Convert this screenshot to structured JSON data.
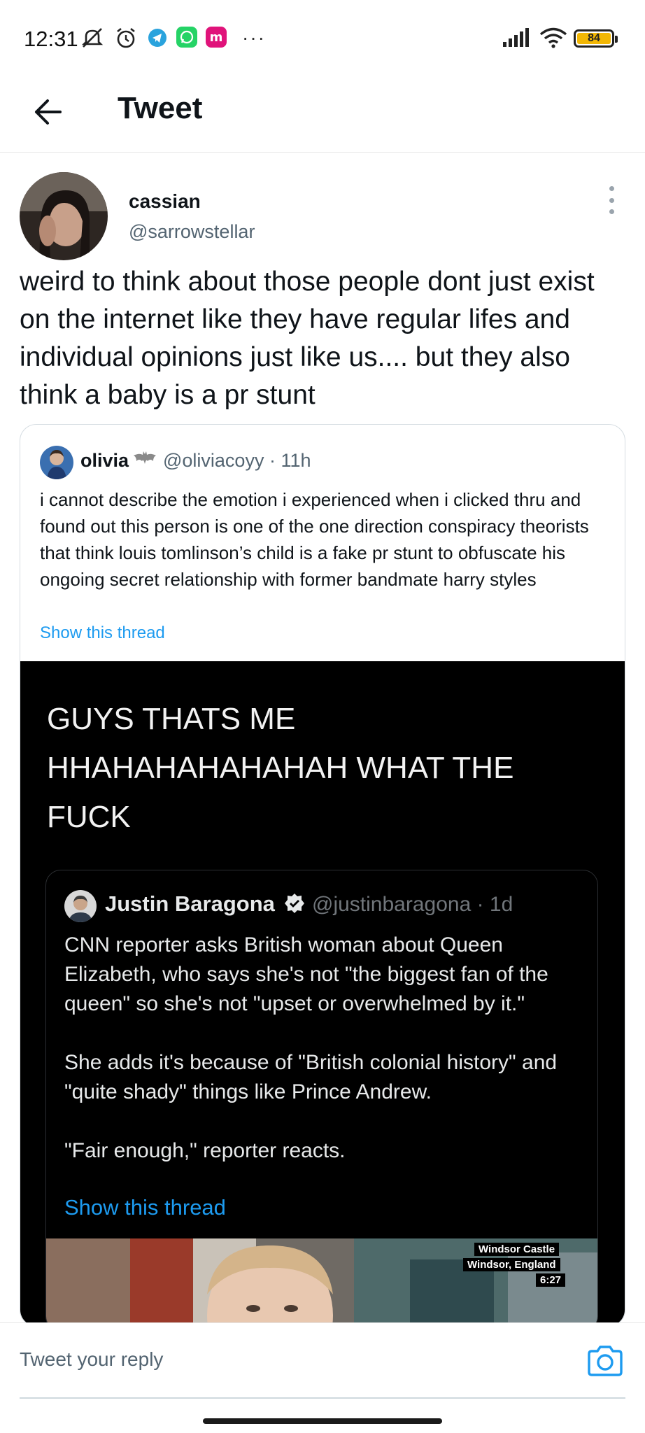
{
  "status_bar": {
    "time": "12:31",
    "battery_level": "84",
    "more_glyph": "···",
    "icons": [
      "notifications-muted-icon",
      "alarm-icon",
      "telegram-icon",
      "whatsapp-icon",
      "messenger-icon",
      "signal-icon",
      "wifi-icon",
      "battery-icon"
    ]
  },
  "header": {
    "title": "Tweet"
  },
  "tweet": {
    "display_name": "cassian",
    "handle": "@sarrowstellar",
    "text": "weird to think about those people dont just exist on the internet like they have regular lifes and individual opinions just like us.... but they also think a baby is a pr stunt"
  },
  "quoted_tweet": {
    "display_name": "olivia",
    "handle": "@oliviacoyy · 11h",
    "text": "i cannot describe the emotion i experienced when i clicked thru and found out this person is one of the one direction conspiracy theorists that think louis tomlinson’s child is a fake pr stunt to obfuscate his ongoing secret relationship with former bandmate harry styles",
    "show_thread": "Show this thread",
    "media": {
      "caption": "GUYS THATS ME HHAHAHAHAHAHAH WHAT THE FUCK",
      "inner_tweet": {
        "display_name": "Justin Baragona",
        "handle": "@justinbaragona · 1d",
        "text": "CNN reporter asks British woman about Queen Elizabeth, who says she's not \"the biggest fan of the queen\" so she's not \"upset or overwhelmed by it.\"\n\nShe adds it's because of \"British colonial history\" and \"quite shady\" things like Prince Andrew.\n\n\"Fair enough,\" reporter reacts.",
        "show_thread": "Show this thread",
        "video_overlay": {
          "line1": "Windsor Castle",
          "line2": "Windsor, England",
          "line3": "6:27"
        }
      }
    }
  },
  "reply": {
    "placeholder": "Tweet your reply"
  },
  "colors": {
    "link_blue": "#1d9bf0",
    "secondary_text": "#536471",
    "battery_fill": "#f2b705"
  }
}
